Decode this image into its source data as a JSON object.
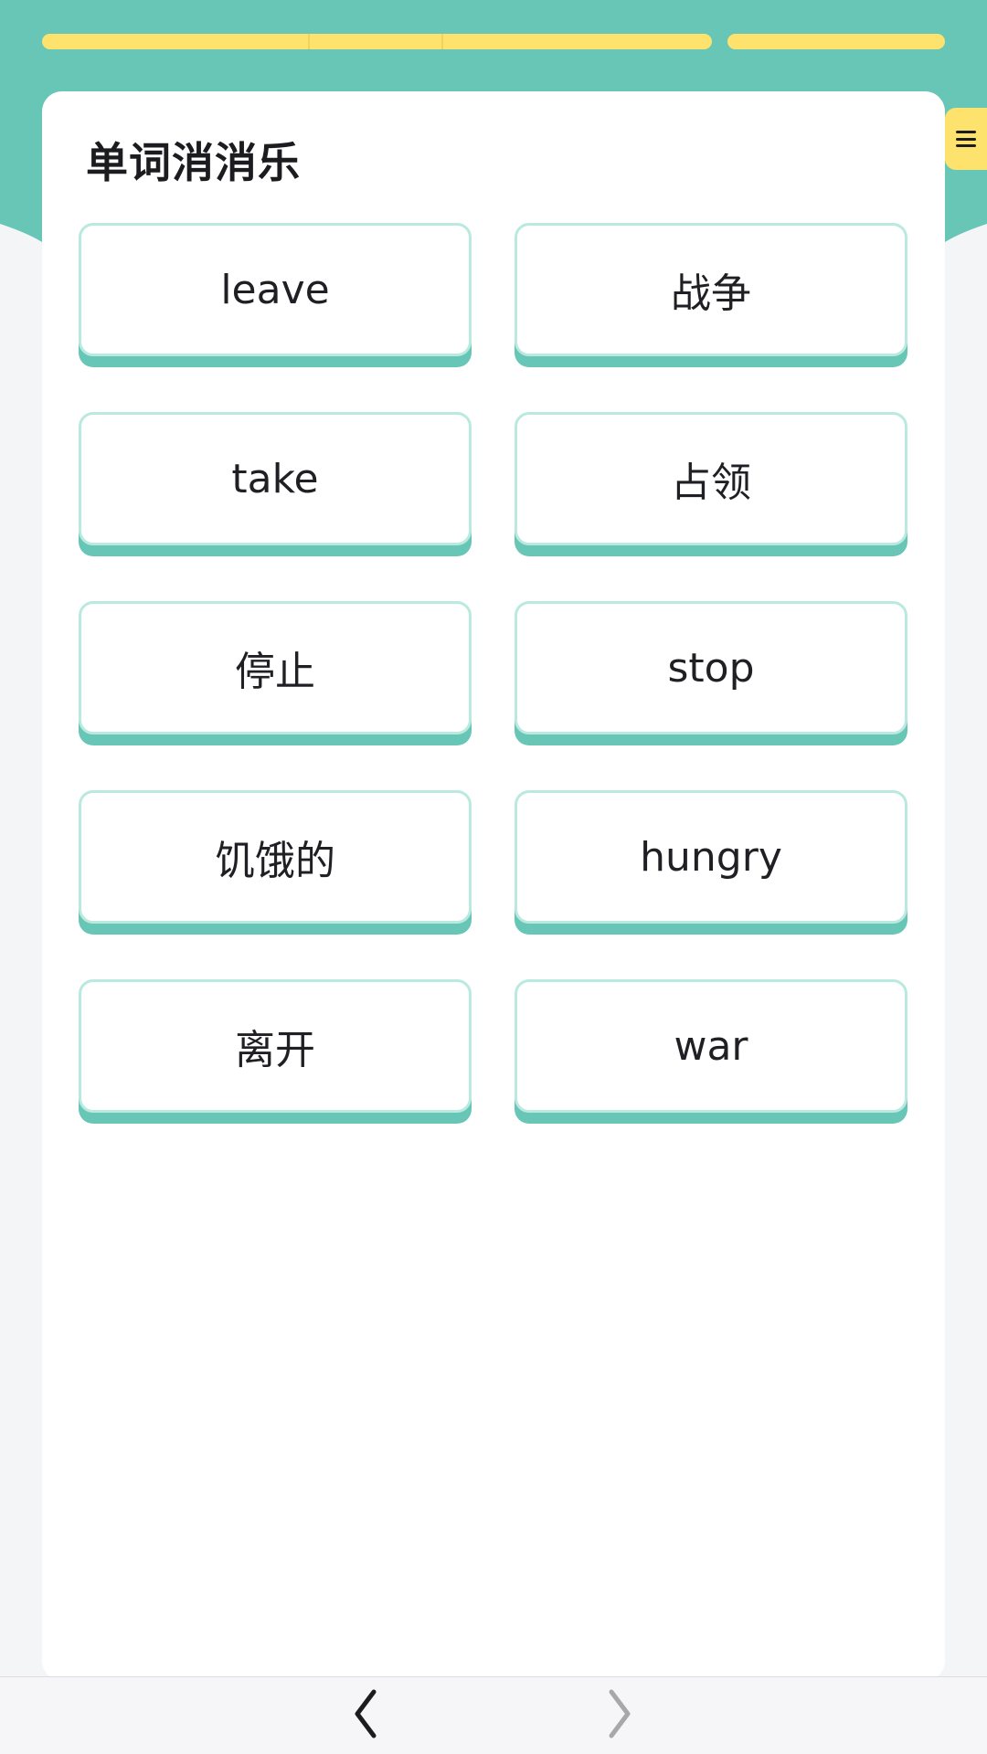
{
  "app": {
    "title": "单词消消乐"
  },
  "progress": {
    "segments_filled": 3,
    "segments_total": 4
  },
  "colors": {
    "header": "#67c6b6",
    "accent": "#fde26e",
    "tile_border": "#b9e9df",
    "tile_shadow": "#67c6b6"
  },
  "menu": {
    "icon": "hamburger-icon"
  },
  "tiles": [
    {
      "text": "leave"
    },
    {
      "text": "战争"
    },
    {
      "text": "take"
    },
    {
      "text": "占领"
    },
    {
      "text": "停止"
    },
    {
      "text": "stop"
    },
    {
      "text": "饥饿的"
    },
    {
      "text": "hungry"
    },
    {
      "text": "离开"
    },
    {
      "text": "war"
    }
  ],
  "nav": {
    "back_icon": "chevron-left-icon",
    "forward_icon": "chevron-right-icon"
  }
}
